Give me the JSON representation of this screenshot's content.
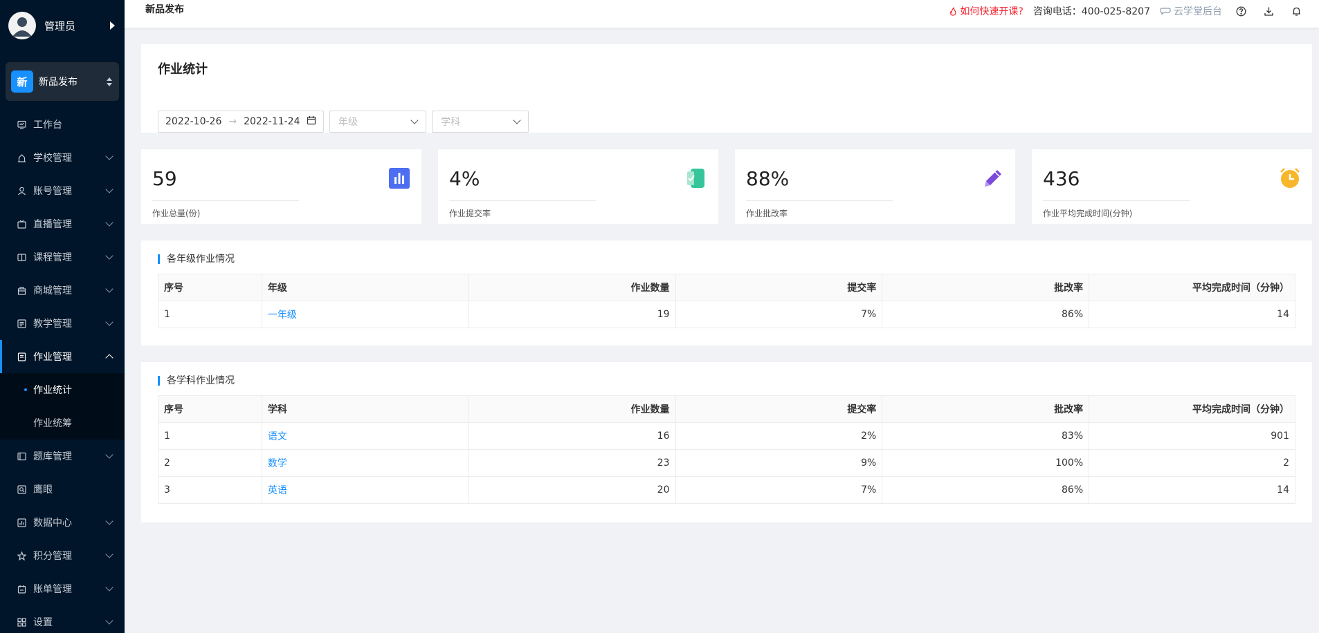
{
  "sidebar": {
    "user_name": "管理员",
    "switcher": {
      "badge": "新",
      "label": "新品发布"
    },
    "items": [
      {
        "label": "工作台",
        "icon": "dashboard-icon"
      },
      {
        "label": "学校管理",
        "icon": "school-icon"
      },
      {
        "label": "账号管理",
        "icon": "user-icon"
      },
      {
        "label": "直播管理",
        "icon": "live-icon"
      },
      {
        "label": "课程管理",
        "icon": "course-icon"
      },
      {
        "label": "商城管理",
        "icon": "shop-icon"
      },
      {
        "label": "教学管理",
        "icon": "teaching-icon"
      },
      {
        "label": "作业管理",
        "icon": "homework-icon"
      },
      {
        "label": "题库管理",
        "icon": "question-bank-icon"
      },
      {
        "label": "鹰眼",
        "icon": "eagle-eye-icon"
      },
      {
        "label": "数据中心",
        "icon": "data-center-icon"
      },
      {
        "label": "积分管理",
        "icon": "points-icon"
      },
      {
        "label": "账单管理",
        "icon": "bill-icon"
      },
      {
        "label": "设置",
        "icon": "settings-icon"
      }
    ],
    "submenu": [
      {
        "label": "作业统计"
      },
      {
        "label": "作业统筹"
      }
    ]
  },
  "header": {
    "title": "新品发布",
    "help_link": "如何快速开课?",
    "hotline": "咨询电话：400-025-8207",
    "backend_link": "云学堂后台"
  },
  "page": {
    "title": "作业统计",
    "date_start": "2022-10-26",
    "date_arrow": "→",
    "date_end": "2022-11-24",
    "grade_placeholder": "年级",
    "subject_placeholder": "学科"
  },
  "stats": [
    {
      "value": "59",
      "label": "作业总量(份)",
      "icon": "bar-chart-icon",
      "color": "#4e6ef2"
    },
    {
      "value": "4%",
      "label": "作业提交率",
      "icon": "submit-icon",
      "color": "#36c59a"
    },
    {
      "value": "88%",
      "label": "作业批改率",
      "icon": "pencil-icon",
      "color": "#7b4ad9"
    },
    {
      "value": "436",
      "label": "作业平均完成时间(分钟)",
      "icon": "alarm-clock-icon",
      "color": "#f7b62b"
    }
  ],
  "grade_table": {
    "title": "各年级作业情况",
    "headers": [
      "序号",
      "年级",
      "作业数量",
      "提交率",
      "批改率",
      "平均完成时间（分钟）"
    ],
    "rows": [
      [
        "1",
        "一年级",
        "19",
        "7%",
        "86%",
        "14"
      ]
    ]
  },
  "subject_table": {
    "title": "各学科作业情况",
    "headers": [
      "序号",
      "学科",
      "作业数量",
      "提交率",
      "批改率",
      "平均完成时间（分钟）"
    ],
    "rows": [
      [
        "1",
        "语文",
        "16",
        "2%",
        "83%",
        "901"
      ],
      [
        "2",
        "数学",
        "23",
        "9%",
        "100%",
        "2"
      ],
      [
        "3",
        "英语",
        "20",
        "7%",
        "86%",
        "14"
      ]
    ]
  }
}
